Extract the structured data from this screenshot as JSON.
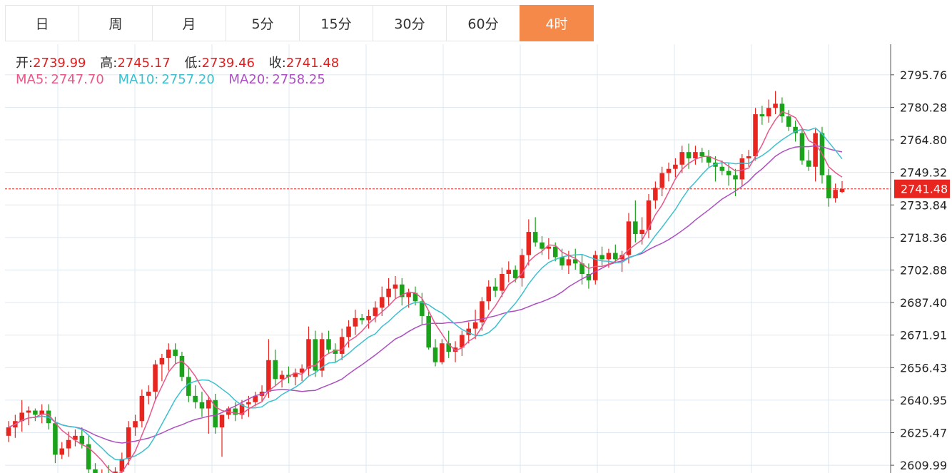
{
  "tabs": [
    {
      "label": "日",
      "active": false
    },
    {
      "label": "周",
      "active": false
    },
    {
      "label": "月",
      "active": false
    },
    {
      "label": "5分",
      "active": false
    },
    {
      "label": "15分",
      "active": false
    },
    {
      "label": "30分",
      "active": false
    },
    {
      "label": "60分",
      "active": false
    },
    {
      "label": "4时",
      "active": true
    }
  ],
  "ohlc": {
    "open_label": "开:",
    "open": "2739.99",
    "high_label": "高:",
    "high": "2745.17",
    "low_label": "低:",
    "low": "2739.46",
    "close_label": "收:",
    "close": "2741.48"
  },
  "ma": {
    "ma5_label": "MA5:",
    "ma5": "2747.70",
    "ma10_label": "MA10:",
    "ma10": "2757.20",
    "ma20_label": "MA20:",
    "ma20": "2758.25"
  },
  "colors": {
    "up": "#e8251f",
    "down": "#1aa31a",
    "ma5": "#e8588a",
    "ma10": "#3cc0cf",
    "ma20": "#ad4fc2",
    "grid": "#dfe8f0",
    "last_price_bg": "#e8251f"
  },
  "chart_data": {
    "type": "candlestick",
    "y_ticks": [
      "2795.76",
      "2780.28",
      "2764.80",
      "2749.32",
      "2733.84",
      "2718.36",
      "2702.88",
      "2687.40",
      "2671.91",
      "2656.43",
      "2640.95",
      "2625.47",
      "2609.99"
    ],
    "last_price": "2741.48",
    "ylim": [
      2606.3,
      2810.3
    ],
    "candles": [
      [
        2624,
        2631,
        2621,
        2628
      ],
      [
        2628,
        2634,
        2623,
        2631
      ],
      [
        2631,
        2641,
        2626,
        2635
      ],
      [
        2635,
        2638,
        2629,
        2636
      ],
      [
        2636,
        2637,
        2631,
        2634
      ],
      [
        2634,
        2639,
        2630,
        2636
      ],
      [
        2636,
        2639,
        2627,
        2630
      ],
      [
        2630,
        2633,
        2611,
        2615
      ],
      [
        2615,
        2621,
        2613,
        2618
      ],
      [
        2618,
        2626,
        2614,
        2622
      ],
      [
        2622,
        2627,
        2619,
        2624
      ],
      [
        2624,
        2628,
        2618,
        2620
      ],
      [
        2620,
        2624,
        2605,
        2608
      ],
      [
        2608,
        2611,
        2601,
        2603
      ],
      [
        2603,
        2608,
        2599,
        2606
      ],
      [
        2606,
        2610,
        2600,
        2604
      ],
      [
        2604,
        2609,
        2602,
        2607
      ],
      [
        2607,
        2616,
        2604,
        2613
      ],
      [
        2613,
        2631,
        2610,
        2628
      ],
      [
        2628,
        2634,
        2624,
        2631
      ],
      [
        2631,
        2646,
        2628,
        2643
      ],
      [
        2643,
        2648,
        2639,
        2645
      ],
      [
        2645,
        2660,
        2641,
        2658
      ],
      [
        2658,
        2663,
        2650,
        2661
      ],
      [
        2661,
        2668,
        2655,
        2665
      ],
      [
        2665,
        2668,
        2658,
        2662
      ],
      [
        2662,
        2664,
        2650,
        2652
      ],
      [
        2652,
        2657,
        2640,
        2643
      ],
      [
        2643,
        2648,
        2637,
        2640
      ],
      [
        2640,
        2645,
        2633,
        2637
      ],
      [
        2637,
        2643,
        2625,
        2641
      ],
      [
        2641,
        2644,
        2625,
        2628
      ],
      [
        2628,
        2634,
        2614,
        2634
      ],
      [
        2634,
        2638,
        2632,
        2637
      ],
      [
        2637,
        2640,
        2631,
        2634
      ],
      [
        2634,
        2641,
        2632,
        2639
      ],
      [
        2639,
        2643,
        2633,
        2640
      ],
      [
        2640,
        2645,
        2638,
        2643
      ],
      [
        2643,
        2648,
        2640,
        2645
      ],
      [
        2645,
        2670,
        2642,
        2660
      ],
      [
        2660,
        2665,
        2648,
        2651
      ],
      [
        2651,
        2655,
        2647,
        2653
      ],
      [
        2653,
        2657,
        2649,
        2652
      ],
      [
        2652,
        2656,
        2648,
        2654
      ],
      [
        2654,
        2658,
        2650,
        2656
      ],
      [
        2656,
        2676,
        2652,
        2670
      ],
      [
        2670,
        2674,
        2652,
        2655
      ],
      [
        2655,
        2673,
        2652,
        2670
      ],
      [
        2670,
        2674,
        2663,
        2665
      ],
      [
        2665,
        2668,
        2659,
        2663
      ],
      [
        2663,
        2675,
        2660,
        2671
      ],
      [
        2671,
        2679,
        2666,
        2676
      ],
      [
        2676,
        2684,
        2672,
        2680
      ],
      [
        2680,
        2682,
        2677,
        2679
      ],
      [
        2679,
        2684,
        2675,
        2681
      ],
      [
        2681,
        2688,
        2678,
        2685
      ],
      [
        2685,
        2695,
        2681,
        2690
      ],
      [
        2690,
        2699,
        2686,
        2694
      ],
      [
        2694,
        2700,
        2689,
        2696
      ],
      [
        2696,
        2699,
        2686,
        2690
      ],
      [
        2690,
        2694,
        2685,
        2692
      ],
      [
        2692,
        2695,
        2686,
        2688
      ],
      [
        2688,
        2692,
        2677,
        2681
      ],
      [
        2681,
        2683,
        2665,
        2666
      ],
      [
        2666,
        2670,
        2657,
        2659
      ],
      [
        2659,
        2670,
        2658,
        2668
      ],
      [
        2668,
        2674,
        2661,
        2664
      ],
      [
        2664,
        2669,
        2659,
        2666
      ],
      [
        2666,
        2674,
        2662,
        2672
      ],
      [
        2672,
        2678,
        2668,
        2675
      ],
      [
        2675,
        2684,
        2670,
        2678
      ],
      [
        2678,
        2690,
        2674,
        2688
      ],
      [
        2688,
        2698,
        2684,
        2695
      ],
      [
        2695,
        2699,
        2690,
        2693
      ],
      [
        2693,
        2704,
        2690,
        2701
      ],
      [
        2701,
        2707,
        2697,
        2703
      ],
      [
        2703,
        2705,
        2697,
        2699
      ],
      [
        2699,
        2713,
        2695,
        2710
      ],
      [
        2710,
        2727,
        2705,
        2721
      ],
      [
        2721,
        2728,
        2714,
        2716
      ],
      [
        2716,
        2719,
        2710,
        2713
      ],
      [
        2713,
        2718,
        2708,
        2714
      ],
      [
        2714,
        2716,
        2707,
        2709
      ],
      [
        2709,
        2713,
        2703,
        2705
      ],
      [
        2705,
        2712,
        2701,
        2708
      ],
      [
        2708,
        2713,
        2703,
        2706
      ],
      [
        2706,
        2710,
        2696,
        2701
      ],
      [
        2701,
        2706,
        2694,
        2698
      ],
      [
        2698,
        2712,
        2696,
        2710
      ],
      [
        2710,
        2714,
        2705,
        2708
      ],
      [
        2708,
        2713,
        2704,
        2711
      ],
      [
        2711,
        2715,
        2706,
        2708
      ],
      [
        2708,
        2712,
        2702,
        2710
      ],
      [
        2710,
        2730,
        2706,
        2726
      ],
      [
        2726,
        2736,
        2716,
        2720
      ],
      [
        2720,
        2728,
        2715,
        2722
      ],
      [
        2722,
        2739,
        2718,
        2736
      ],
      [
        2736,
        2745,
        2732,
        2742
      ],
      [
        2742,
        2752,
        2738,
        2749
      ],
      [
        2749,
        2754,
        2745,
        2751
      ],
      [
        2751,
        2756,
        2747,
        2753
      ],
      [
        2753,
        2762,
        2749,
        2759
      ],
      [
        2759,
        2763,
        2751,
        2756
      ],
      [
        2756,
        2762,
        2753,
        2759
      ],
      [
        2759,
        2761,
        2754,
        2757
      ],
      [
        2757,
        2760,
        2752,
        2754
      ],
      [
        2754,
        2757,
        2745,
        2752
      ],
      [
        2752,
        2755,
        2748,
        2750
      ],
      [
        2750,
        2754,
        2743,
        2748
      ],
      [
        2748,
        2751,
        2738,
        2746
      ],
      [
        2746,
        2758,
        2743,
        2756
      ],
      [
        2756,
        2760,
        2752,
        2757
      ],
      [
        2757,
        2780,
        2755,
        2777
      ],
      [
        2777,
        2781,
        2772,
        2776
      ],
      [
        2776,
        2784,
        2773,
        2780
      ],
      [
        2780,
        2788,
        2777,
        2782
      ],
      [
        2782,
        2785,
        2773,
        2776
      ],
      [
        2776,
        2779,
        2769,
        2771
      ],
      [
        2771,
        2774,
        2764,
        2768
      ],
      [
        2768,
        2770,
        2753,
        2755
      ],
      [
        2755,
        2760,
        2750,
        2752
      ],
      [
        2752,
        2770,
        2745,
        2768
      ],
      [
        2768,
        2771,
        2744,
        2748
      ],
      [
        2748,
        2751,
        2733,
        2737
      ],
      [
        2737,
        2744,
        2735,
        2741
      ],
      [
        2739.99,
        2745.17,
        2739.46,
        2741.48
      ]
    ]
  }
}
